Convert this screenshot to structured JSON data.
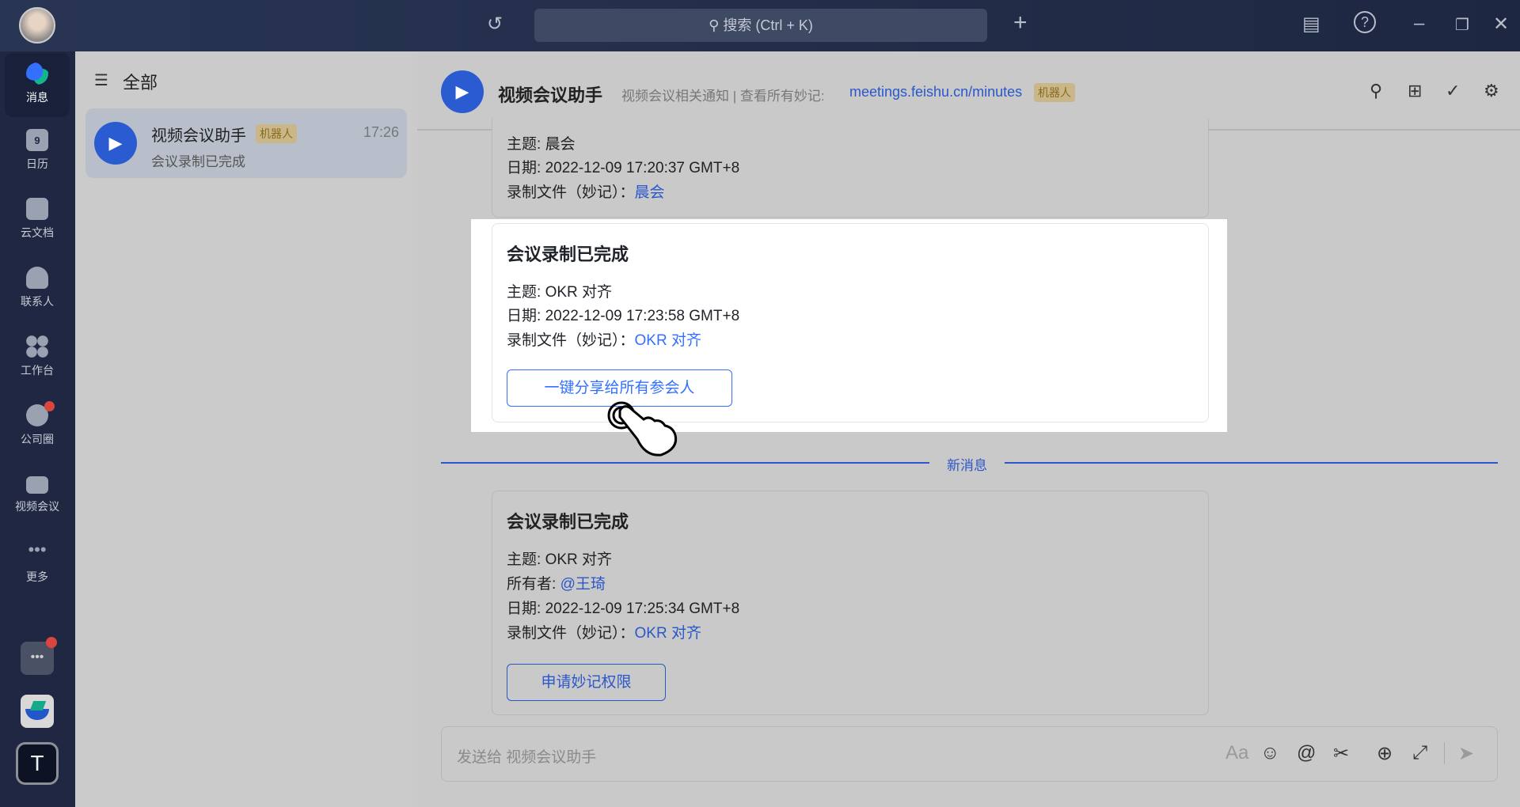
{
  "topbar": {
    "search_placeholder": "搜索 (Ctrl + K)"
  },
  "rail": {
    "items": [
      {
        "label": "消息"
      },
      {
        "label": "日历",
        "day": "9"
      },
      {
        "label": "云文档"
      },
      {
        "label": "联系人"
      },
      {
        "label": "工作台"
      },
      {
        "label": "公司圈"
      },
      {
        "label": "视频会议"
      },
      {
        "label": "更多"
      }
    ],
    "app_t": "T"
  },
  "conv_list": {
    "filter": "全部",
    "items": [
      {
        "name": "视频会议助手",
        "badge": "机器人",
        "time": "17:26",
        "preview": "会议录制已完成"
      }
    ]
  },
  "chat": {
    "title": "视频会议助手",
    "desc": "视频会议相关通知 | 查看所有妙记:",
    "desc_link": "meetings.feishu.cn/minutes",
    "badge": "机器人",
    "messages": [
      {
        "topic_label": "主题:",
        "topic": "晨会",
        "date_label": "日期:",
        "date": "2022-12-09 17:20:37 GMT+8",
        "file_label": "录制文件（妙记）：",
        "file": "晨会"
      },
      {
        "title": "会议录制已完成",
        "topic_label": "主题:",
        "topic": "OKR 对齐",
        "date_label": "日期:",
        "date": "2022-12-09 17:23:58 GMT+8",
        "file_label": "录制文件（妙记）：",
        "file": "OKR 对齐",
        "button": "一键分享给所有参会人"
      },
      {
        "title": "会议录制已完成",
        "topic_label": "主题:",
        "topic": "OKR 对齐",
        "owner_label": "所有者:",
        "owner": "@王琦",
        "date_label": "日期:",
        "date": "2022-12-09 17:25:34 GMT+8",
        "file_label": "录制文件（妙记）：",
        "file": "OKR 对齐",
        "button": "申请妙记权限"
      }
    ],
    "new_divider": "新消息",
    "input_placeholder": "发送给 视频会议助手",
    "font_icon": "Aa"
  },
  "colors": {
    "accent": "#3370ff",
    "badge": "#d9c186"
  }
}
